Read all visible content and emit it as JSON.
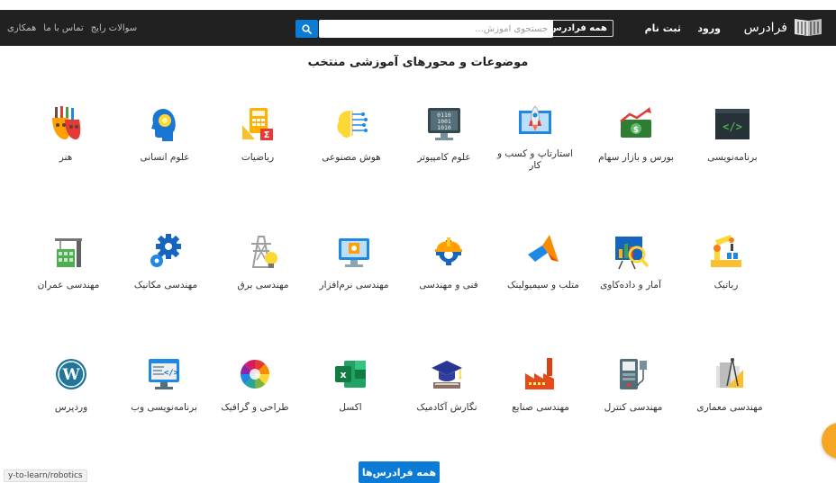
{
  "header": {
    "brand": "فرادرس",
    "login": "ورود",
    "signup": "ثبت نام",
    "all_courses": "همه فرادرس‌ها",
    "search_placeholder": "جستجوی آموزش...",
    "links": [
      "سوالات رایج",
      "تماس با ما",
      "همکاری"
    ]
  },
  "section_title": "موضوعات و محورهای آموزشی منتخب",
  "categories": [
    {
      "label": "برنامه‌نویسی",
      "icon": "code-monitor-icon"
    },
    {
      "label": "بورس و بازار سهام",
      "icon": "stock-money-icon"
    },
    {
      "label": "استارتاپ و کسب و کار",
      "icon": "startup-rocket-icon"
    },
    {
      "label": "علوم کامپیوتر",
      "icon": "binary-monitor-icon"
    },
    {
      "label": "هوش مصنوعی",
      "icon": "ai-brain-icon"
    },
    {
      "label": "ریاضیات",
      "icon": "math-icon"
    },
    {
      "label": "علوم انسانی",
      "icon": "human-head-icon"
    },
    {
      "label": "هنر",
      "icon": "art-masks-icon"
    },
    {
      "label": "رباتیک",
      "icon": "robot-arm-icon"
    },
    {
      "label": "آمار و داده‌کاوی",
      "icon": "statistics-chart-icon"
    },
    {
      "label": "متلب و سیمیولینک",
      "icon": "matlab-icon"
    },
    {
      "label": "فنی و مهندسی",
      "icon": "engineering-helmet-icon"
    },
    {
      "label": "مهندسی نرم‌افزار",
      "icon": "software-monitor-icon"
    },
    {
      "label": "مهندسی برق",
      "icon": "power-tower-icon"
    },
    {
      "label": "مهندسی مکانیک",
      "icon": "gears-icon"
    },
    {
      "label": "مهندسی عمران",
      "icon": "construction-icon"
    },
    {
      "label": "مهندسی معماری",
      "icon": "architecture-icon"
    },
    {
      "label": "مهندسی کنترل",
      "icon": "control-device-icon"
    },
    {
      "label": "مهندسی صنایع",
      "icon": "factory-icon"
    },
    {
      "label": "نگارش آکادمیک",
      "icon": "graduation-book-icon"
    },
    {
      "label": "اکسل",
      "icon": "excel-icon"
    },
    {
      "label": "طراحی و گرافیک",
      "icon": "color-wheel-icon"
    },
    {
      "label": "برنامه‌نویسی وب",
      "icon": "web-code-icon"
    },
    {
      "label": "وردپرس",
      "icon": "wordpress-icon"
    }
  ],
  "status_url": "y-to-learn/robotics",
  "all_courses_button": "همه فرادرس‌ها",
  "colors": {
    "topbar": "#212121",
    "accent": "#0b7bd6",
    "fab": "#f5a623"
  }
}
